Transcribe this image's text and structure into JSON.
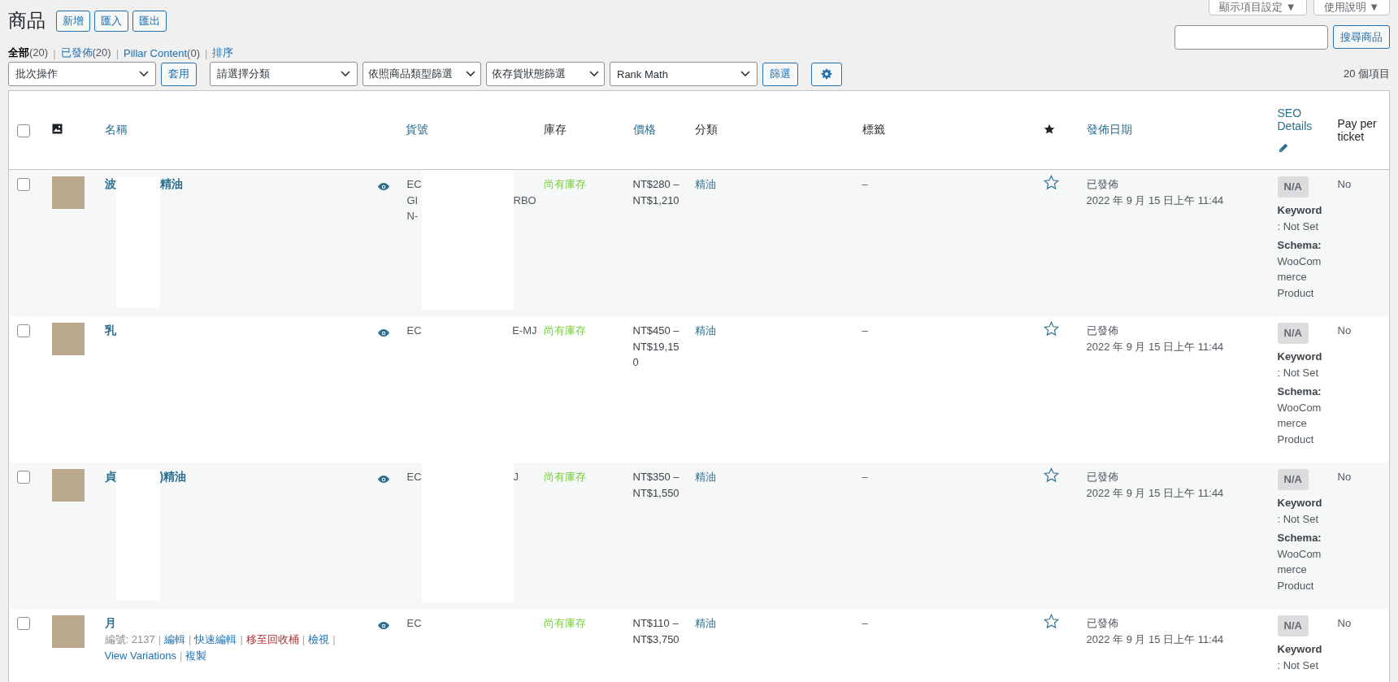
{
  "page_title": "商品",
  "title_actions": [
    "新增",
    "匯入",
    "匯出"
  ],
  "screen_meta": [
    {
      "label": "顯示項目設定",
      "caret": "▼"
    },
    {
      "label": "使用說明",
      "caret": "▼"
    }
  ],
  "views": [
    {
      "label": "全部",
      "count": "(20)",
      "selected": true
    },
    {
      "label": "已發佈",
      "count": "(20)",
      "selected": false
    },
    {
      "label": "Pillar Content",
      "count": "(0)",
      "selected": false
    },
    {
      "label": "排序",
      "selected": false
    }
  ],
  "search": {
    "button": "搜尋商品"
  },
  "filters": {
    "bulk": "批次操作",
    "apply": "套用",
    "category": "請選擇分類",
    "type": "依照商品類型篩選",
    "stock": "依存貨狀態篩選",
    "rank_math": "Rank Math",
    "filter": "篩選"
  },
  "item_count": "20 個項目",
  "separator": "|",
  "select_all_checked": false,
  "columns": [
    {
      "kind": "checkbox"
    },
    {
      "kind": "image"
    },
    {
      "kind": "text",
      "label": "名稱",
      "sortable": true
    },
    {
      "kind": "text",
      "label": "貨號",
      "sortable": true
    },
    {
      "kind": "text",
      "label": "庫存",
      "sortable": false
    },
    {
      "kind": "text",
      "label": "價格",
      "sortable": true
    },
    {
      "kind": "text",
      "label": "分類",
      "sortable": false
    },
    {
      "kind": "text",
      "label": "標籤",
      "sortable": false
    },
    {
      "kind": "featured"
    },
    {
      "kind": "text",
      "label": "發佈日期",
      "sortable": true
    },
    {
      "kind": "seo",
      "label": "SEO Details",
      "sortable": true
    },
    {
      "kind": "text",
      "label": "Pay per ticket",
      "sortable": false
    }
  ],
  "rows": [
    {
      "checked": false,
      "name_parts": [
        "波",
        "精油"
      ],
      "sku_lines": [
        {
          "left": "EC"
        },
        {
          "left": "GI",
          "right": "RBO"
        },
        {
          "left": "N-"
        }
      ],
      "stock": {
        "kind": "instock",
        "label": "尚有庫存"
      },
      "price": "NT$280 – NT$1,210",
      "category": "精油",
      "tags": "–",
      "featured": false,
      "status": "已發佈",
      "date": "2022 年 9 月 15 日上午 11:44",
      "seo_score": "N/A",
      "keyword": "**Keyword**: Not Set",
      "schema": "**Schema:** WooCommerce Product",
      "pay": "No"
    },
    {
      "checked": false,
      "name_parts": [
        "乳"
      ],
      "sku_lines": [
        {
          "left": "EC",
          "right": "E-MJ"
        }
      ],
      "stock": {
        "kind": "instock",
        "label": "尚有庫存"
      },
      "price": "NT$450 – NT$19,150",
      "category": "精油",
      "tags": "–",
      "featured": false,
      "status": "已發佈",
      "date": "2022 年 9 月 15 日上午 11:44",
      "seo_score": "N/A",
      "keyword": "**Keyword**: Not Set",
      "schema": "**Schema:** WooCommerce Product",
      "pay": "No"
    },
    {
      "checked": false,
      "name_parts": [
        "貞",
        ")精油"
      ],
      "sku_lines": [
        {
          "left": "EC",
          "right": "J"
        }
      ],
      "stock": {
        "kind": "instock",
        "label": "尚有庫存"
      },
      "price": "NT$350 – NT$1,550",
      "category": "精油",
      "tags": "–",
      "featured": false,
      "status": "已發佈",
      "date": "2022 年 9 月 15 日上午 11:44",
      "seo_score": "N/A",
      "keyword": "**Keyword**: Not Set",
      "schema": "**Schema:** WooCommerce Product",
      "pay": "No"
    },
    {
      "checked": false,
      "name_parts": [
        "月"
      ],
      "row_actions": {
        "id": "編號: 2137",
        "links": [
          {
            "kind": "link",
            "label": "編輯"
          },
          {
            "kind": "link",
            "label": "快速編輯"
          },
          {
            "kind": "trash",
            "label": "移至回收桶"
          },
          {
            "kind": "link",
            "label": "檢視"
          },
          {
            "kind": "link",
            "label": "View Variations"
          },
          {
            "kind": "link",
            "label": "複製"
          }
        ]
      },
      "sku_lines": [
        {
          "left": "EC"
        }
      ],
      "stock": {
        "kind": "instock",
        "label": "尚有庫存"
      },
      "price": "NT$110 – NT$3,750",
      "category": "精油",
      "tags": "–",
      "featured": false,
      "status": "已發佈",
      "date": "2022 年 9 月 15 日上午 11:44",
      "seo_score": "N/A",
      "keyword": "**Keyword**: Not Set",
      "pay": "No"
    }
  ]
}
